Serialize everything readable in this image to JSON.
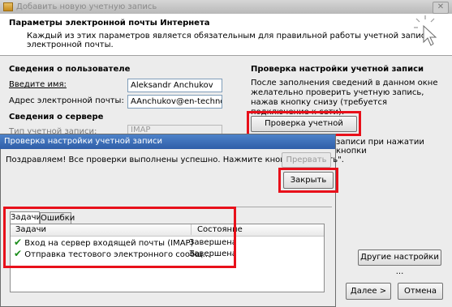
{
  "window": {
    "title": "Добавить новую учетную запись",
    "close_glyph": "✕",
    "header_title": "Параметры электронной почты Интернета",
    "header_subtitle": "Каждый из этих параметров является обязательным для правильной работы учетной записи электронной почты."
  },
  "user_info": {
    "section_title": "Сведения о пользователе",
    "name_label": "Введите имя:",
    "name_value": "Aleksandr Anchukov",
    "email_label": "Адрес электронной почты:",
    "email_value": "AAnchukov@en-techno.ru"
  },
  "server_info": {
    "section_title": "Сведения о сервере",
    "account_type_label": "Тип учетной записи:",
    "account_type_value": "IMAP"
  },
  "test_settings": {
    "section_title": "Проверка настройки учетной записи",
    "description": "После заполнения сведений в данном окне желательно проверить учетную запись, нажав кнопку снизу (требуется подключение к сети).",
    "test_button": "Проверка учетной записи...",
    "partial_text": "записи при нажатии кнопки"
  },
  "footer": {
    "more_settings_button": "Другие настройки ...",
    "next_button": "Далее >",
    "cancel_button": "Отмена"
  },
  "dialog": {
    "title": "Проверка настройки учетной записи",
    "message": "Поздравляем! Все проверки выполнены успешно. Нажмите кнопку \"Закрыть\".",
    "stop_button": "Прервать",
    "close_button": "Закрыть",
    "tabs": [
      "Задачи",
      "Ошибки"
    ],
    "columns": {
      "task": "Задачи",
      "status": "Состояние"
    },
    "rows": [
      {
        "task": "Вход на сервер входящей почты (IMAP)",
        "status": "Завершена"
      },
      {
        "task": "Отправка тестового электронного сообщ...",
        "status": "Завершена"
      }
    ]
  },
  "colors": {
    "highlight": "#e8101a",
    "dialog_title_bar": "#2f5ea8",
    "check": "#1a8c1a"
  }
}
